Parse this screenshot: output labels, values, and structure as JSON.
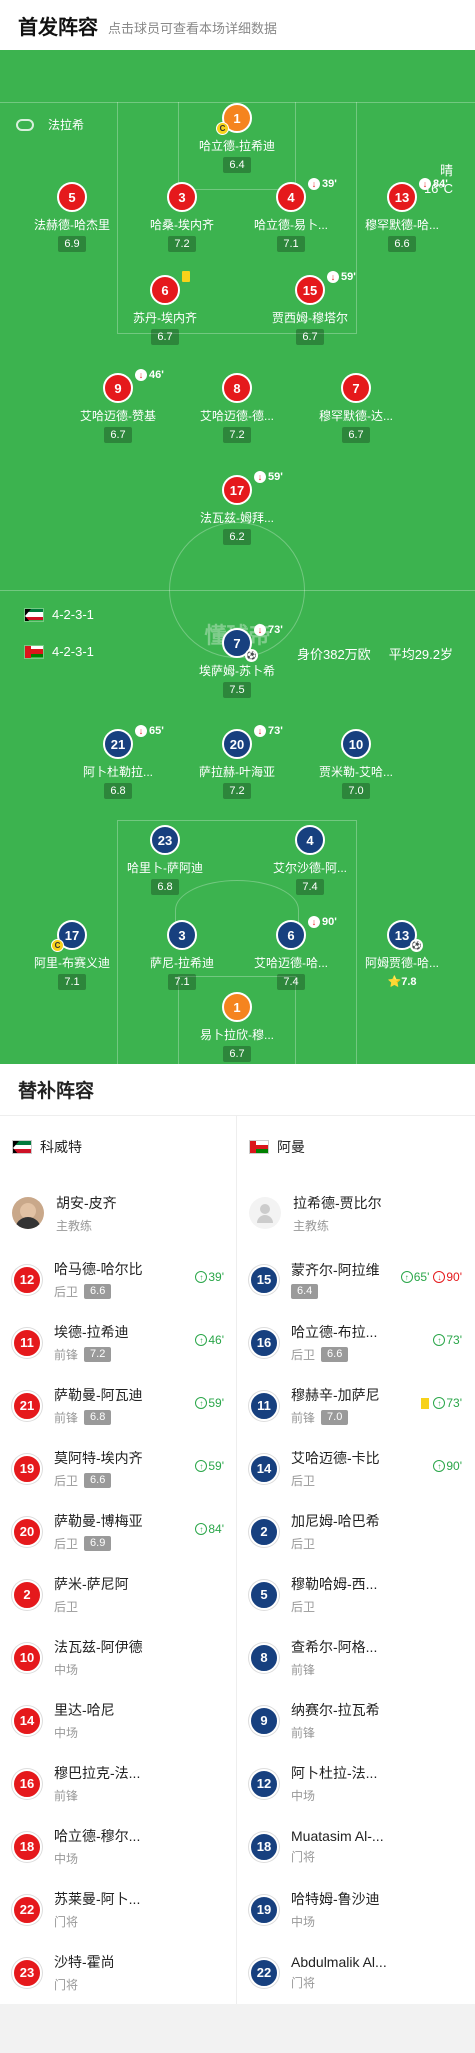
{
  "header": {
    "title": "首发阵容",
    "subtitle": "点击球员可查看本场详细数据"
  },
  "pitch": {
    "referee_name": "法拉希",
    "weather": "晴",
    "temperature": "16°C",
    "watermark": "懂球帝",
    "home": {
      "formation": "4-2-3-1",
      "flag_colors": [
        "#007a3d",
        "#ffffff",
        "#ce1126",
        "#000000"
      ]
    },
    "away": {
      "formation": "4-2-3-1",
      "market_value": "身价382万欧",
      "avg_age": "平均29.2岁",
      "flag_colors": [
        "#ffffff",
        "#db161b",
        "#008000"
      ]
    },
    "home_players": [
      {
        "num": "1",
        "name": "哈立德-拉希迪",
        "rating": "6.4",
        "color": "orange",
        "captain": true,
        "events": []
      },
      {
        "num": "5",
        "name": "法赫德-哈杰里",
        "rating": "6.9",
        "color": "red",
        "events": []
      },
      {
        "num": "3",
        "name": "哈桑-埃内齐",
        "rating": "7.2",
        "color": "red",
        "events": []
      },
      {
        "num": "4",
        "name": "哈立德-易卜...",
        "rating": "7.1",
        "color": "red",
        "events": [
          {
            "type": "sub",
            "time": "39'"
          }
        ]
      },
      {
        "num": "13",
        "name": "穆罕默德-哈...",
        "rating": "6.6",
        "color": "red",
        "events": [
          {
            "type": "sub",
            "time": "84'"
          }
        ]
      },
      {
        "num": "6",
        "name": "苏丹-埃内齐",
        "rating": "6.7",
        "color": "red",
        "events": [
          {
            "type": "yellow",
            "time": ""
          }
        ]
      },
      {
        "num": "15",
        "name": "贾西姆-穆塔尔",
        "rating": "6.7",
        "color": "red",
        "events": [
          {
            "type": "sub",
            "time": "59'"
          }
        ]
      },
      {
        "num": "9",
        "name": "艾哈迈德-赞基",
        "rating": "6.7",
        "color": "red",
        "events": [
          {
            "type": "sub",
            "time": "46'"
          }
        ]
      },
      {
        "num": "8",
        "name": "艾哈迈德-德...",
        "rating": "7.2",
        "color": "red",
        "events": []
      },
      {
        "num": "7",
        "name": "穆罕默德-达...",
        "rating": "6.7",
        "color": "red",
        "events": []
      },
      {
        "num": "17",
        "name": "法瓦兹-姆拜...",
        "rating": "6.2",
        "color": "red",
        "events": [
          {
            "type": "sub",
            "time": "59'"
          }
        ]
      }
    ],
    "away_players": [
      {
        "num": "7",
        "name": "埃萨姆-苏卜希",
        "rating": "7.5",
        "color": "blue",
        "events": [
          {
            "type": "sub",
            "time": "73'"
          }
        ],
        "goal": true
      },
      {
        "num": "21",
        "name": "阿卜杜勒拉...",
        "rating": "6.8",
        "color": "blue",
        "events": [
          {
            "type": "sub",
            "time": "65'"
          }
        ]
      },
      {
        "num": "20",
        "name": "萨拉赫-叶海亚",
        "rating": "7.2",
        "color": "blue",
        "events": [
          {
            "type": "sub",
            "time": "73'"
          }
        ]
      },
      {
        "num": "10",
        "name": "贾米勒-艾哈...",
        "rating": "7.0",
        "color": "blue",
        "events": []
      },
      {
        "num": "23",
        "name": "哈里卜-萨阿迪",
        "rating": "6.8",
        "color": "blue",
        "events": []
      },
      {
        "num": "4",
        "name": "艾尔沙德-阿...",
        "rating": "7.4",
        "color": "blue",
        "events": []
      },
      {
        "num": "17",
        "name": "阿里-布赛义迪",
        "rating": "7.1",
        "color": "blue",
        "captain": true,
        "events": []
      },
      {
        "num": "3",
        "name": "萨尼-拉希迪",
        "rating": "7.1",
        "color": "blue",
        "events": []
      },
      {
        "num": "6",
        "name": "艾哈迈德-哈...",
        "rating": "7.4",
        "color": "blue",
        "events": [
          {
            "type": "sub",
            "time": "90'"
          }
        ]
      },
      {
        "num": "13",
        "name": "阿姆贾德-哈...",
        "rating": "7.8",
        "color": "blue",
        "best": true,
        "events": []
      },
      {
        "num": "1",
        "name": "易卜拉欣-穆...",
        "rating": "6.7",
        "color": "orange",
        "events": []
      }
    ]
  },
  "subs": {
    "title": "替补阵容",
    "home": {
      "team": "科威特",
      "coach": {
        "name": "胡安-皮齐",
        "role": "主教练"
      },
      "players": [
        {
          "num": "12",
          "name": "哈马德-哈尔比",
          "pos": "后卫",
          "rating": "6.6",
          "in": "39'"
        },
        {
          "num": "11",
          "name": "埃德-拉希迪",
          "pos": "前锋",
          "rating": "7.2",
          "in": "46'"
        },
        {
          "num": "21",
          "name": "萨勒曼-阿瓦迪",
          "pos": "前锋",
          "rating": "6.8",
          "in": "59'"
        },
        {
          "num": "19",
          "name": "莫阿特-埃内齐",
          "pos": "后卫",
          "rating": "6.6",
          "in": "59'"
        },
        {
          "num": "20",
          "name": "萨勒曼-博梅亚",
          "pos": "后卫",
          "rating": "6.9",
          "in": "84'"
        },
        {
          "num": "2",
          "name": "萨米-萨尼阿",
          "pos": "后卫"
        },
        {
          "num": "10",
          "name": "法瓦兹-阿伊德",
          "pos": "中场"
        },
        {
          "num": "14",
          "name": "里达-哈尼",
          "pos": "中场"
        },
        {
          "num": "16",
          "name": "穆巴拉克-法...",
          "pos": "前锋"
        },
        {
          "num": "18",
          "name": "哈立德-穆尔...",
          "pos": "中场"
        },
        {
          "num": "22",
          "name": "苏莱曼-阿卜...",
          "pos": "门将"
        },
        {
          "num": "23",
          "name": "沙特-霍尚",
          "pos": "门将"
        }
      ]
    },
    "away": {
      "team": "阿曼",
      "coach": {
        "name": "拉希德-贾比尔",
        "role": "主教练"
      },
      "players": [
        {
          "num": "15",
          "name": "蒙齐尔-阿拉维",
          "pos": "",
          "rating": "6.4",
          "in": "65'",
          "out": "90'"
        },
        {
          "num": "16",
          "name": "哈立德-布拉...",
          "pos": "后卫",
          "rating": "6.6",
          "in": "73'"
        },
        {
          "num": "11",
          "name": "穆赫辛-加萨尼",
          "pos": "前锋",
          "rating": "7.0",
          "in": "73'",
          "yellow": true
        },
        {
          "num": "14",
          "name": "艾哈迈德-卡比",
          "pos": "后卫",
          "in": "90'"
        },
        {
          "num": "2",
          "name": "加尼姆-哈巴希",
          "pos": "后卫"
        },
        {
          "num": "5",
          "name": "穆勒哈姆-西...",
          "pos": "后卫"
        },
        {
          "num": "8",
          "name": "查希尔-阿格...",
          "pos": "前锋"
        },
        {
          "num": "9",
          "name": "纳赛尔-拉瓦希",
          "pos": "前锋"
        },
        {
          "num": "12",
          "name": "阿卜杜拉-法...",
          "pos": "中场"
        },
        {
          "num": "18",
          "name": "Muatasim Al-...",
          "pos": "门将"
        },
        {
          "num": "19",
          "name": "哈特姆-鲁沙迪",
          "pos": "中场"
        },
        {
          "num": "22",
          "name": "Abdulmalik Al...",
          "pos": "门将"
        }
      ]
    }
  }
}
